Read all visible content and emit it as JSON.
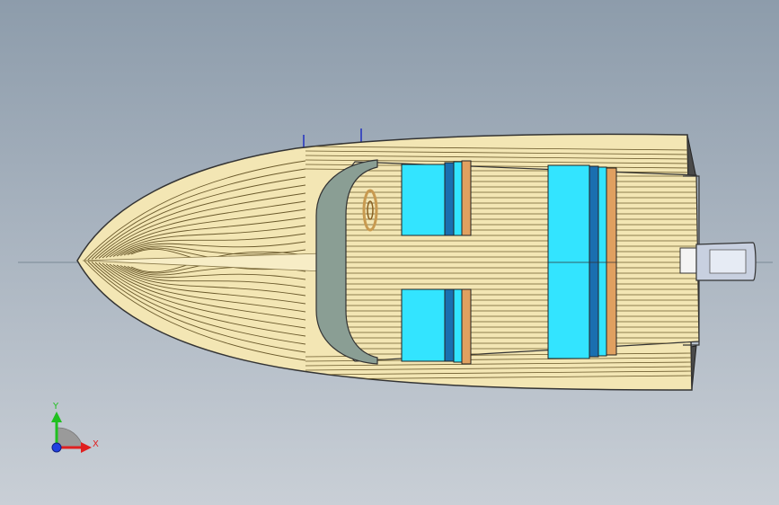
{
  "viewport": {
    "background_top": "#8d9cab",
    "background_bottom": "#c9cfd6"
  },
  "model": {
    "hull_color": "#f3e6b4",
    "plank_line_color": "#6b5a2c",
    "chine_color": "#3c3c3c",
    "windshield_color": "#8a9e94",
    "seat_cushion_color": "#33e4ff",
    "seat_back_color": "#1a6fb0",
    "seat_trim_color": "#e0a060",
    "outboard_color": "#c8d0e0",
    "steering_wheel_color": "#c89a50"
  },
  "triad": {
    "x_label": "X",
    "y_label": "Y",
    "x_color": "#e02020",
    "y_color": "#20c020",
    "z_color": "#2040e0"
  }
}
